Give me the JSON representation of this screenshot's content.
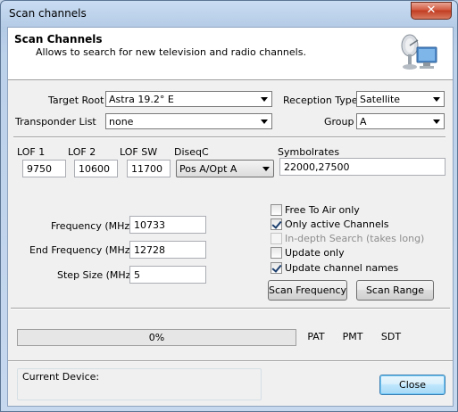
{
  "window": {
    "title": "Scan channels",
    "close_glyph": "✕"
  },
  "header": {
    "title": "Scan Channels",
    "subtitle": "Allows to search for new television and radio channels.",
    "icon": "satellite-dish-monitor-icon"
  },
  "form": {
    "target_root": {
      "label": "Target Root",
      "value": "Astra 19.2° E"
    },
    "reception_type": {
      "label": "Reception Type",
      "value": "Satellite"
    },
    "transponder_list": {
      "label": "Transponder List",
      "value": "none"
    },
    "group": {
      "label": "Group",
      "value": "A"
    },
    "lof1": {
      "label": "LOF 1",
      "value": "9750"
    },
    "lof2": {
      "label": "LOF 2",
      "value": "10600"
    },
    "lofsw": {
      "label": "LOF SW",
      "value": "11700"
    },
    "diseqc": {
      "label": "DiseqC",
      "value": "Pos A/Opt A"
    },
    "symbolrates": {
      "label": "Symbolrates",
      "value": "22000,27500"
    },
    "frequency": {
      "label": "Frequency (MHz)",
      "value": "10733"
    },
    "end_frequency": {
      "label": "End  Frequency (MHz)",
      "value": "12728"
    },
    "step_size": {
      "label": "Step Size (MHz)",
      "value": "5"
    }
  },
  "options": [
    {
      "label": "Free To Air only",
      "checked": false,
      "enabled": true
    },
    {
      "label": "Only active Channels",
      "checked": true,
      "enabled": true
    },
    {
      "label": "In-depth Search (takes long)",
      "checked": false,
      "enabled": false
    },
    {
      "label": "Update only",
      "checked": false,
      "enabled": true
    },
    {
      "label": "Update channel names",
      "checked": true,
      "enabled": true
    }
  ],
  "buttons": {
    "scan_frequency": "Scan Frequency",
    "scan_range": "Scan Range",
    "pat": "PAT",
    "pmt": "PMT",
    "sdt": "SDT",
    "close": "Close"
  },
  "progress": {
    "text": "0%",
    "fraction": 0
  },
  "device": {
    "label": "Current Device:"
  }
}
